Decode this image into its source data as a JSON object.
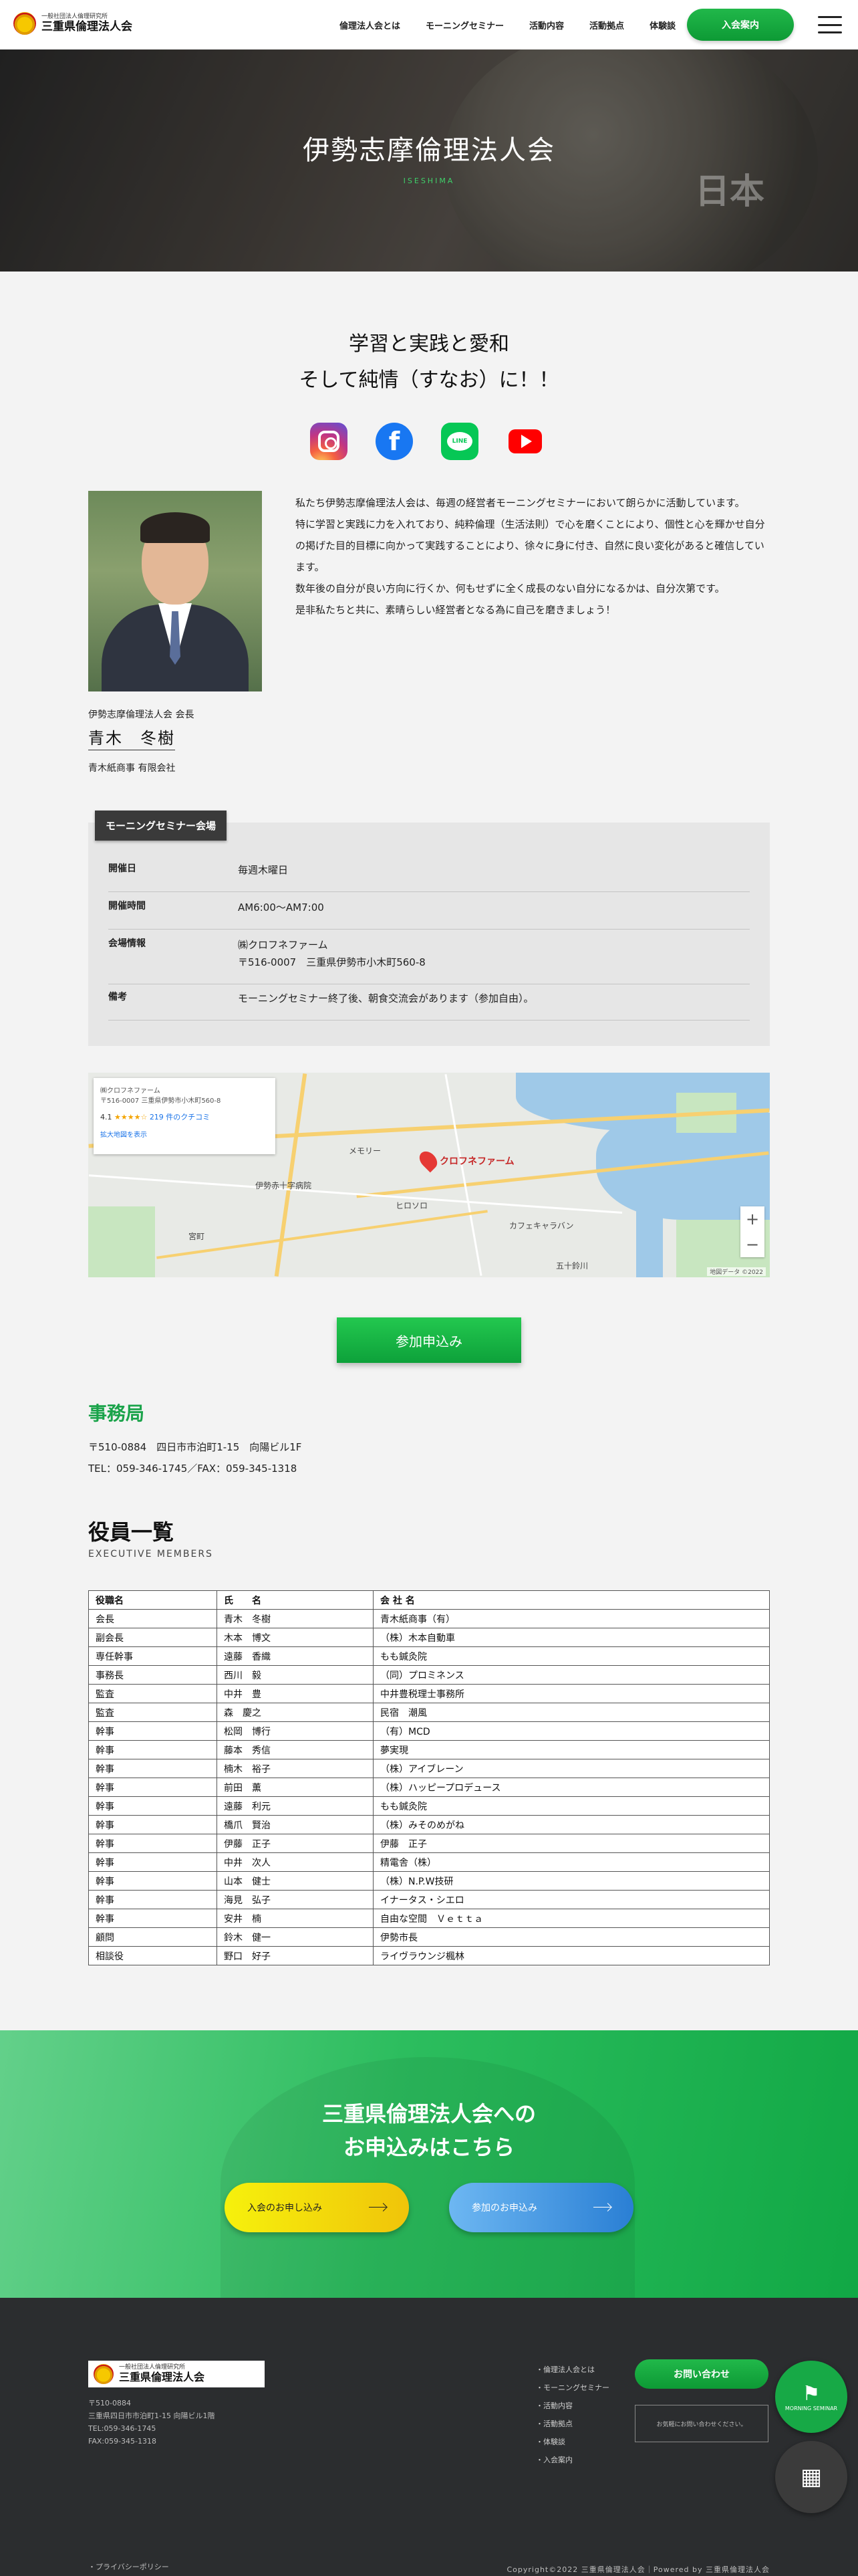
{
  "header": {
    "logo_sub": "一般社団法人倫理研究所",
    "logo_main": "三重県倫理法人会",
    "nav": [
      "倫理法人会とは",
      "モーニングセミナー",
      "活動内容",
      "活動拠点",
      "体験談"
    ],
    "join_label": "入会案内"
  },
  "hero": {
    "title": "伊勢志摩倫理法人会",
    "subtitle": "ISESHIMA",
    "map_text": "日本"
  },
  "tagline": [
    "学習と実践と愛和",
    "そして純情（すなお）に！！"
  ],
  "social": {
    "line_text": "LINE"
  },
  "chair": {
    "title": "伊勢志摩倫理法人会 会長",
    "name": "青木　冬樹",
    "company": "青木紙商事 有限会社"
  },
  "intro": [
    "私たち伊勢志摩倫理法人会は、毎週の経営者モーニングセミナーにおいて朗らかに活動しています。",
    "特に学習と実践に力を入れており、純粋倫理（生活法則）で心を磨くことにより、個性と心を輝かせ自分の掲げた目的目標に向かって実践することにより、徐々に身に付き、自然に良い変化があると確信しています。",
    "数年後の自分が良い方向に行くか、何もせずに全く成長のない自分になるかは、自分次第です。",
    "是非私たちと共に、素晴らしい経営者となる為に自己を磨きましょう！"
  ],
  "seminar": {
    "label": "モーニングセミナー会場",
    "rows": [
      {
        "key": "開催日",
        "value": [
          "毎週木曜日"
        ]
      },
      {
        "key": "開催時間",
        "value": [
          "AM6:00〜AM7:00"
        ]
      },
      {
        "key": "会場情報",
        "value": [
          "㈱クロフネファーム",
          "〒516-0007　三重県伊勢市小木町560-8"
        ]
      },
      {
        "key": "備考",
        "value": [
          "モーニングセミナー終了後、朝食交流会があります（参加自由）。"
        ]
      }
    ]
  },
  "map": {
    "card_name": "㈱クロフネファーム",
    "card_addr": "〒516-0007 三重県伊勢市小木町560-8",
    "rating": "4.1",
    "stars": "★★★★☆",
    "reviews": "219 件のクチコミ",
    "link": "拡大地図を表示",
    "pin_label": "クロフネファーム",
    "places": [
      "メモリー",
      "伊勢赤十字病院",
      "ヒロソロ",
      "カフェキャラバン",
      "宮町",
      "五十鈴川"
    ],
    "copyright": "地図データ ©2022"
  },
  "apply_label": "参加申込み",
  "office": {
    "title": "事務局",
    "address": "〒510-0884　四日市市泊町1-15　向陽ビル1F",
    "phone": "TEL：059-346-1745／FAX：059-345-1318"
  },
  "exec": {
    "title": "役員一覧",
    "subtitle": "EXECUTIVE MEMBERS",
    "headers": [
      "役職名",
      "氏　　名",
      "会 社 名"
    ],
    "rows": [
      [
        "会長",
        "青木　冬樹",
        "青木紙商事（有）"
      ],
      [
        "副会長",
        "木本　博文",
        "（株）木本自動車"
      ],
      [
        "専任幹事",
        "遠藤　香織",
        "もも鍼灸院"
      ],
      [
        "事務長",
        "西川　毅",
        "（同）プロミネンス"
      ],
      [
        "監査",
        "中井　豊",
        "中井豊税理士事務所"
      ],
      [
        "監査",
        "森　慶之",
        "民宿　潮風"
      ],
      [
        "幹事",
        "松岡　博行",
        "（有）MCD"
      ],
      [
        "幹事",
        "藤本　秀信",
        "夢実現"
      ],
      [
        "幹事",
        "楠木　裕子",
        "（株）アイブレーン"
      ],
      [
        "幹事",
        "前田　薫",
        "（株）ハッピープロデュース"
      ],
      [
        "幹事",
        "遠藤　利元",
        "もも鍼灸院"
      ],
      [
        "幹事",
        "橋爪　賢治",
        "（株）みそのめがね"
      ],
      [
        "幹事",
        "伊藤　正子",
        "伊藤　正子"
      ],
      [
        "幹事",
        "中井　次人",
        "精電舎（株）"
      ],
      [
        "幹事",
        "山本　健士",
        "（株）N.P.W技研"
      ],
      [
        "幹事",
        "海見　弘子",
        "イナータス・シエロ"
      ],
      [
        "幹事",
        "安井　楠",
        "自由な空間　Ｖｅｔｔａ"
      ],
      [
        "顧問",
        "鈴木　健一",
        "伊勢市長"
      ],
      [
        "相談役",
        "野口　好子",
        "ライヴラウンジ楓林"
      ]
    ]
  },
  "cta": {
    "title": [
      "三重県倫理法人会への",
      "お申込みはこちら"
    ],
    "join_label": "入会のお申し込み",
    "participate_label": "参加のお申込み"
  },
  "footer": {
    "logo_sub": "一般社団法人倫理研究所",
    "logo_main": "三重県倫理法人会",
    "info": [
      "〒510-0884",
      "三重県四日市市泊町1-15 向陽ビル1階",
      "TEL:059-346-1745",
      "FAX:059-345-1318"
    ],
    "nav": [
      "倫理法人会とは",
      "モーニングセミナー",
      "活動内容",
      "活動拠点",
      "体験談",
      "入会案内"
    ],
    "contact_label": "お問い合わせ",
    "notice": "お気軽にお問い合わせください。",
    "privacy": "・プライバシーポリシー",
    "copyright": "Copyright©2022 三重県倫理法人会｜Powered by 三重県倫理法人会",
    "float_label": "MORNING SEMINAR"
  }
}
